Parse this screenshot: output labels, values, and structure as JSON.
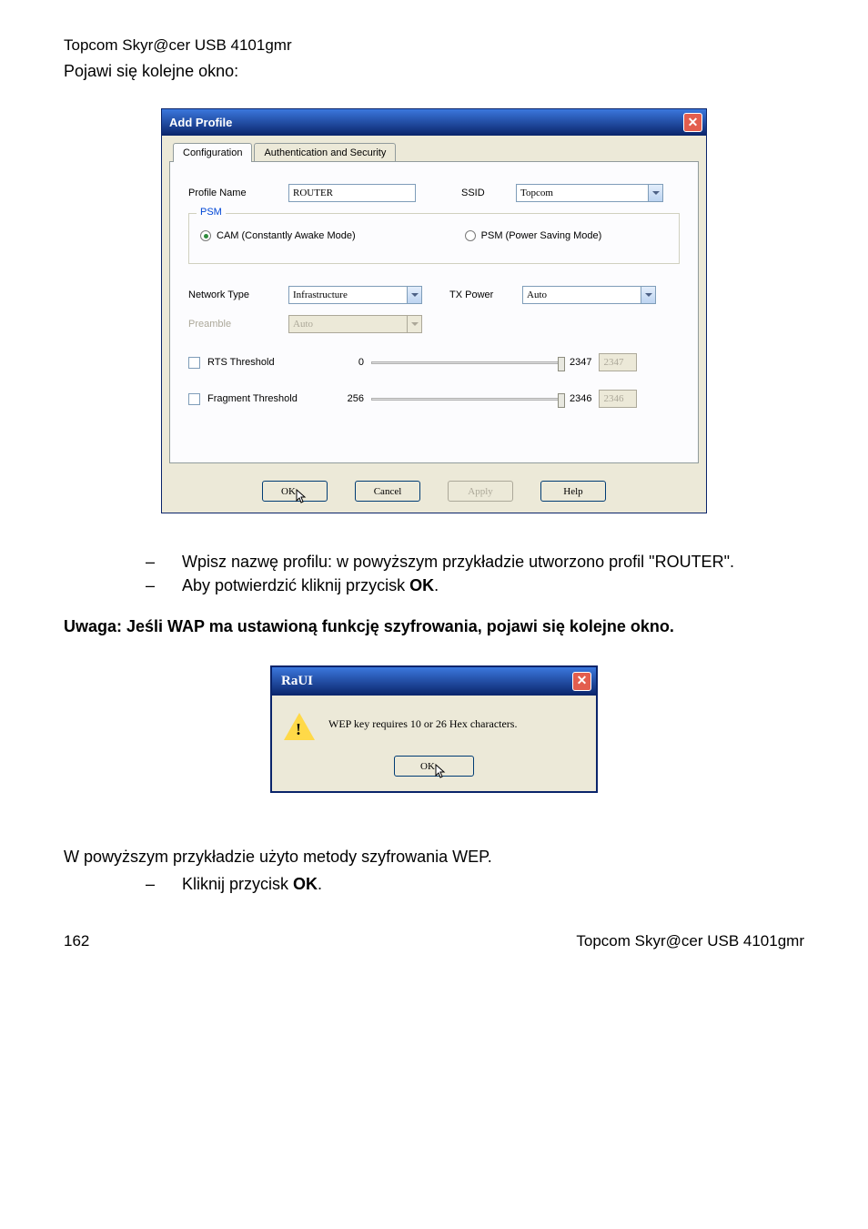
{
  "header": {
    "product": "Topcom Skyr@cer USB 4101gmr"
  },
  "intro": "Pojawi się kolejne okno:",
  "dialog": {
    "title": "Add Profile",
    "tabs": [
      {
        "label": "Configuration",
        "active": true
      },
      {
        "label": "Authentication and Security",
        "active": false
      }
    ],
    "profileName": {
      "label": "Profile Name",
      "value": "ROUTER"
    },
    "ssid": {
      "label": "SSID",
      "value": "Topcom"
    },
    "psm": {
      "groupTitle": "PSM",
      "options": [
        {
          "label": "CAM (Constantly Awake Mode)",
          "selected": true
        },
        {
          "label": "PSM (Power Saving Mode)",
          "selected": false
        }
      ]
    },
    "networkType": {
      "label": "Network Type",
      "value": "Infrastructure"
    },
    "txPower": {
      "label": "TX Power",
      "value": "Auto"
    },
    "preamble": {
      "label": "Preamble",
      "value": "Auto"
    },
    "rts": {
      "label": "RTS Threshold",
      "min": "0",
      "max": "2347",
      "value": "2347"
    },
    "fragment": {
      "label": "Fragment Threshold",
      "min": "256",
      "max": "2346",
      "value": "2346"
    },
    "buttons": {
      "ok": "OK",
      "cancel": "Cancel",
      "apply": "Apply",
      "help": "Help"
    }
  },
  "bullets1": [
    "Wpisz nazwę profilu: w powyższym przykładzie utworzono profil \"ROUTER\".",
    "Aby potwierdzić kliknij przycisk "
  ],
  "bullets1_bold": "OK",
  "note": "Uwaga: Jeśli WAP ma ustawioną funkcję szyfrowania, pojawi się kolejne okno.",
  "alert": {
    "title": "RaUI",
    "message": "WEP key requires 10 or 26 Hex characters.",
    "ok": "OK"
  },
  "body2": "W powyższym przykładzie użyto metody szyfrowania WEP.",
  "bullets2": [
    "Kliknij przycisk "
  ],
  "bullets2_bold": "OK",
  "footer": {
    "page": "162",
    "product": "Topcom Skyr@cer USB 4101gmr"
  }
}
